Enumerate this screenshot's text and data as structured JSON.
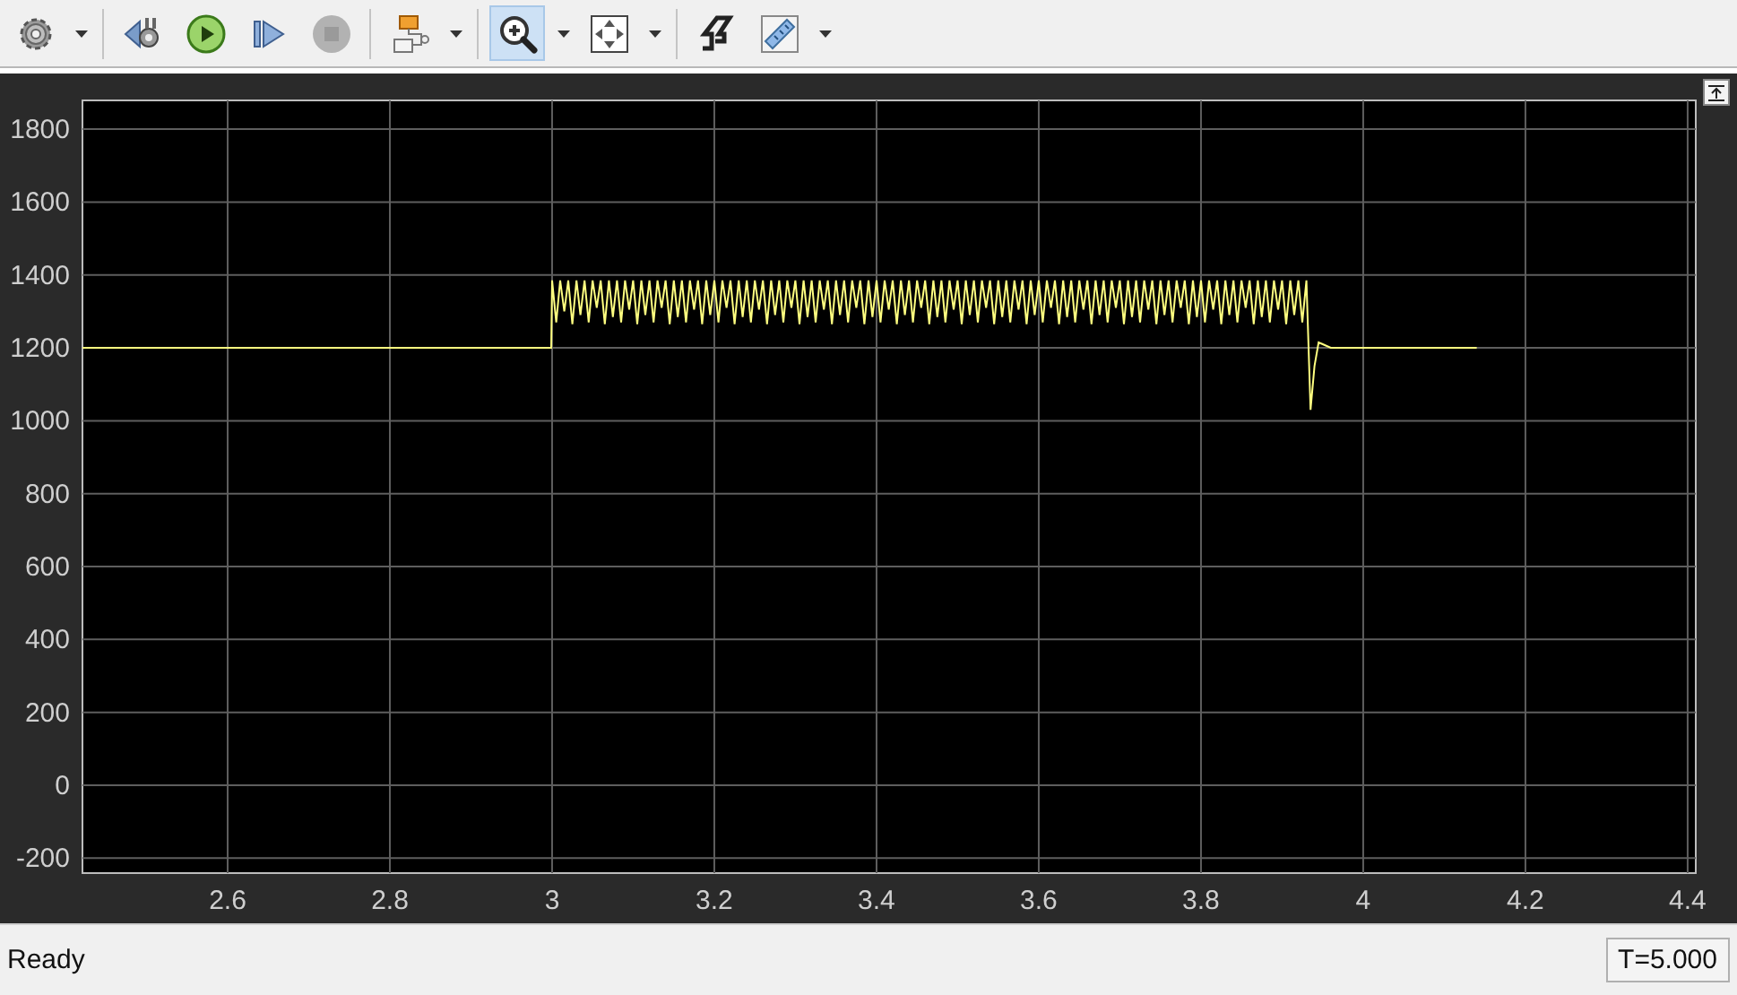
{
  "toolbar": {
    "groups": [
      [
        {
          "kind": "settings",
          "dropdown": true,
          "selected": false,
          "disabled": false
        }
      ],
      [
        {
          "kind": "step_back",
          "dropdown": false,
          "selected": false,
          "disabled": false
        },
        {
          "kind": "run",
          "dropdown": false,
          "selected": false,
          "disabled": false
        },
        {
          "kind": "step_forward",
          "dropdown": false,
          "selected": false,
          "disabled": false
        },
        {
          "kind": "stop",
          "dropdown": false,
          "selected": false,
          "disabled": true
        }
      ],
      [
        {
          "kind": "highlight",
          "dropdown": true,
          "selected": false,
          "disabled": false
        }
      ],
      [
        {
          "kind": "zoom",
          "dropdown": true,
          "selected": true,
          "disabled": false
        },
        {
          "kind": "fit",
          "dropdown": true,
          "selected": false,
          "disabled": false
        }
      ],
      [
        {
          "kind": "triggers",
          "dropdown": false,
          "selected": false,
          "disabled": false
        },
        {
          "kind": "measure",
          "dropdown": true,
          "selected": false,
          "disabled": false
        }
      ]
    ]
  },
  "scope": {
    "chart_data": {
      "type": "line",
      "grid": true,
      "xlim": [
        2.421,
        4.41
      ],
      "ylim": [
        -241,
        1879
      ],
      "xticks": [
        {
          "value": 2.6,
          "label": "2.6"
        },
        {
          "value": 2.8,
          "label": "2.8"
        },
        {
          "value": 3,
          "label": "3"
        },
        {
          "value": 3.2,
          "label": "3.2"
        },
        {
          "value": 3.4,
          "label": "3.4"
        },
        {
          "value": 3.6,
          "label": "3.6"
        },
        {
          "value": 3.8,
          "label": "3.8"
        },
        {
          "value": 4,
          "label": "4"
        },
        {
          "value": 4.2,
          "label": "4.2"
        },
        {
          "value": 4.4,
          "label": "4.4"
        }
      ],
      "yticks": [
        {
          "value": -200,
          "label": "-200"
        },
        {
          "value": 0,
          "label": "0"
        },
        {
          "value": 200,
          "label": "200"
        },
        {
          "value": 400,
          "label": "400"
        },
        {
          "value": 600,
          "label": "600"
        },
        {
          "value": 800,
          "label": "800"
        },
        {
          "value": 1000,
          "label": "1000"
        },
        {
          "value": 1200,
          "label": "1200"
        },
        {
          "value": 1400,
          "label": "1400"
        },
        {
          "value": 1600,
          "label": "1600"
        },
        {
          "value": 1800,
          "label": "1800"
        }
      ],
      "x": [
        2.421,
        2.999,
        3.0,
        3.005,
        3.01,
        3.015,
        3.02,
        3.025,
        3.03,
        3.035,
        3.04,
        3.045,
        3.05,
        3.055,
        3.06,
        3.065,
        3.07,
        3.075,
        3.08,
        3.085,
        3.09,
        3.095,
        3.1,
        3.105,
        3.11,
        3.115,
        3.12,
        3.125,
        3.13,
        3.135,
        3.14,
        3.145,
        3.15,
        3.155,
        3.16,
        3.165,
        3.17,
        3.175,
        3.18,
        3.185,
        3.19,
        3.195,
        3.2,
        3.205,
        3.21,
        3.215,
        3.22,
        3.225,
        3.23,
        3.235,
        3.24,
        3.245,
        3.25,
        3.255,
        3.26,
        3.265,
        3.27,
        3.275,
        3.28,
        3.285,
        3.29,
        3.295,
        3.3,
        3.305,
        3.31,
        3.315,
        3.32,
        3.325,
        3.33,
        3.335,
        3.34,
        3.345,
        3.35,
        3.355,
        3.36,
        3.365,
        3.37,
        3.375,
        3.38,
        3.385,
        3.39,
        3.395,
        3.4,
        3.405,
        3.41,
        3.415,
        3.42,
        3.425,
        3.43,
        3.435,
        3.44,
        3.445,
        3.45,
        3.455,
        3.46,
        3.465,
        3.47,
        3.475,
        3.48,
        3.485,
        3.49,
        3.495,
        3.5,
        3.505,
        3.51,
        3.515,
        3.52,
        3.525,
        3.53,
        3.535,
        3.54,
        3.545,
        3.55,
        3.555,
        3.56,
        3.565,
        3.57,
        3.575,
        3.58,
        3.585,
        3.59,
        3.595,
        3.6,
        3.605,
        3.61,
        3.615,
        3.62,
        3.625,
        3.63,
        3.635,
        3.64,
        3.645,
        3.65,
        3.655,
        3.66,
        3.665,
        3.67,
        3.675,
        3.68,
        3.685,
        3.69,
        3.695,
        3.7,
        3.705,
        3.71,
        3.715,
        3.72,
        3.725,
        3.73,
        3.735,
        3.74,
        3.745,
        3.75,
        3.755,
        3.76,
        3.765,
        3.77,
        3.775,
        3.78,
        3.785,
        3.79,
        3.795,
        3.8,
        3.805,
        3.81,
        3.815,
        3.82,
        3.825,
        3.83,
        3.835,
        3.84,
        3.845,
        3.85,
        3.855,
        3.86,
        3.865,
        3.87,
        3.875,
        3.88,
        3.885,
        3.89,
        3.895,
        3.9,
        3.905,
        3.91,
        3.915,
        3.92,
        3.925,
        3.93,
        3.935,
        3.94,
        3.945,
        3.95,
        3.96,
        4.13,
        4.14
      ],
      "series": [
        {
          "color": "#ffff80",
          "values": [
            1200,
            1200,
            1385,
            1270,
            1385,
            1300,
            1385,
            1265,
            1385,
            1290,
            1385,
            1270,
            1385,
            1310,
            1385,
            1265,
            1385,
            1285,
            1385,
            1270,
            1385,
            1305,
            1385,
            1265,
            1385,
            1290,
            1385,
            1270,
            1385,
            1310,
            1385,
            1265,
            1385,
            1285,
            1385,
            1270,
            1385,
            1305,
            1385,
            1265,
            1385,
            1290,
            1385,
            1270,
            1385,
            1310,
            1385,
            1265,
            1385,
            1285,
            1385,
            1270,
            1385,
            1305,
            1385,
            1265,
            1385,
            1290,
            1385,
            1270,
            1385,
            1310,
            1385,
            1265,
            1385,
            1285,
            1385,
            1270,
            1385,
            1305,
            1385,
            1265,
            1385,
            1290,
            1385,
            1270,
            1385,
            1310,
            1385,
            1265,
            1385,
            1285,
            1385,
            1270,
            1385,
            1305,
            1385,
            1265,
            1385,
            1290,
            1385,
            1270,
            1385,
            1310,
            1385,
            1265,
            1385,
            1285,
            1385,
            1270,
            1385,
            1305,
            1385,
            1265,
            1385,
            1290,
            1385,
            1270,
            1385,
            1310,
            1385,
            1265,
            1385,
            1285,
            1385,
            1270,
            1385,
            1305,
            1385,
            1265,
            1385,
            1290,
            1385,
            1270,
            1385,
            1310,
            1385,
            1265,
            1385,
            1285,
            1385,
            1270,
            1385,
            1305,
            1385,
            1265,
            1385,
            1290,
            1385,
            1270,
            1385,
            1310,
            1385,
            1265,
            1385,
            1285,
            1385,
            1270,
            1385,
            1305,
            1385,
            1265,
            1385,
            1290,
            1385,
            1270,
            1385,
            1310,
            1385,
            1265,
            1385,
            1285,
            1385,
            1270,
            1385,
            1305,
            1385,
            1265,
            1385,
            1290,
            1385,
            1270,
            1385,
            1310,
            1385,
            1265,
            1385,
            1285,
            1385,
            1270,
            1385,
            1305,
            1385,
            1265,
            1385,
            1290,
            1385,
            1270,
            1385,
            1030,
            1150,
            1215,
            1210,
            1200,
            1200,
            1200
          ]
        }
      ]
    }
  },
  "status_bar": {
    "status": "Ready",
    "time": "T=5.000"
  }
}
